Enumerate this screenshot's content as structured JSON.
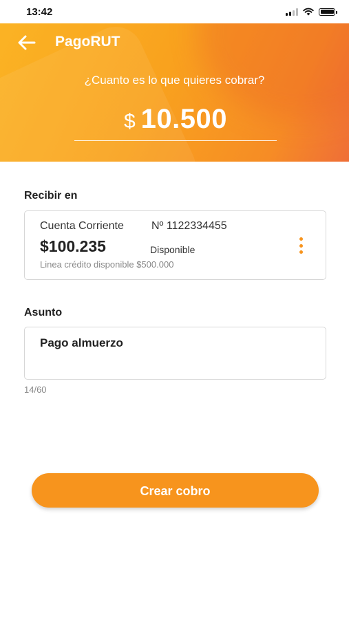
{
  "status_bar": {
    "time": "13:42"
  },
  "header": {
    "title": "PagoRUT",
    "question": "¿Cuanto es lo que quieres cobrar?",
    "currency": "$",
    "amount": "10.500"
  },
  "receive": {
    "label": "Recibir en",
    "account_type": "Cuenta Corriente",
    "account_number": "Nº 1122334455",
    "balance": "$100.235",
    "balance_label": "Disponible",
    "credit_line": "Linea crédito disponible $500.000"
  },
  "subject": {
    "label": "Asunto",
    "value": "Pago almuerzo",
    "counter": "14/60"
  },
  "actions": {
    "create_label": "Crear cobro"
  },
  "colors": {
    "accent": "#f7941d",
    "header_start": "#fbb324",
    "header_end": "#ef6e37"
  }
}
